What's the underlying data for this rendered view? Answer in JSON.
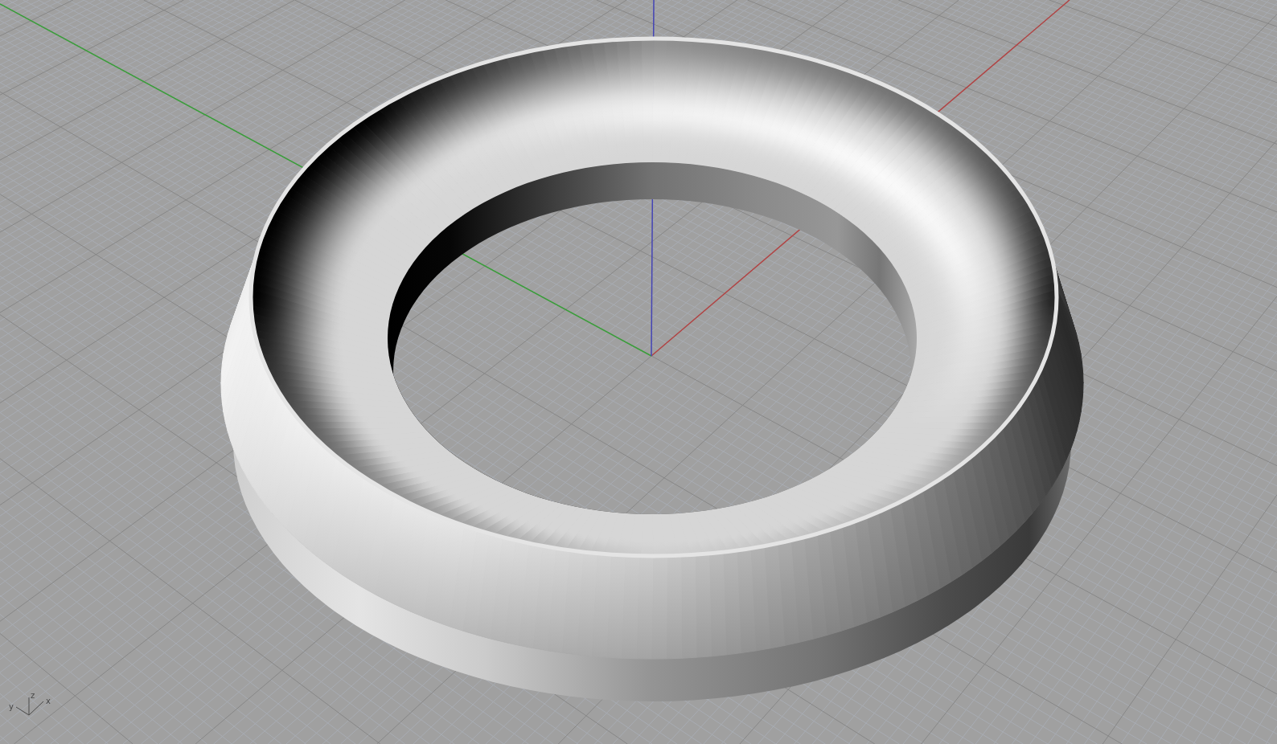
{
  "viewport": {
    "axis_triad": {
      "labels": [
        "y",
        "z",
        "x"
      ]
    }
  }
}
